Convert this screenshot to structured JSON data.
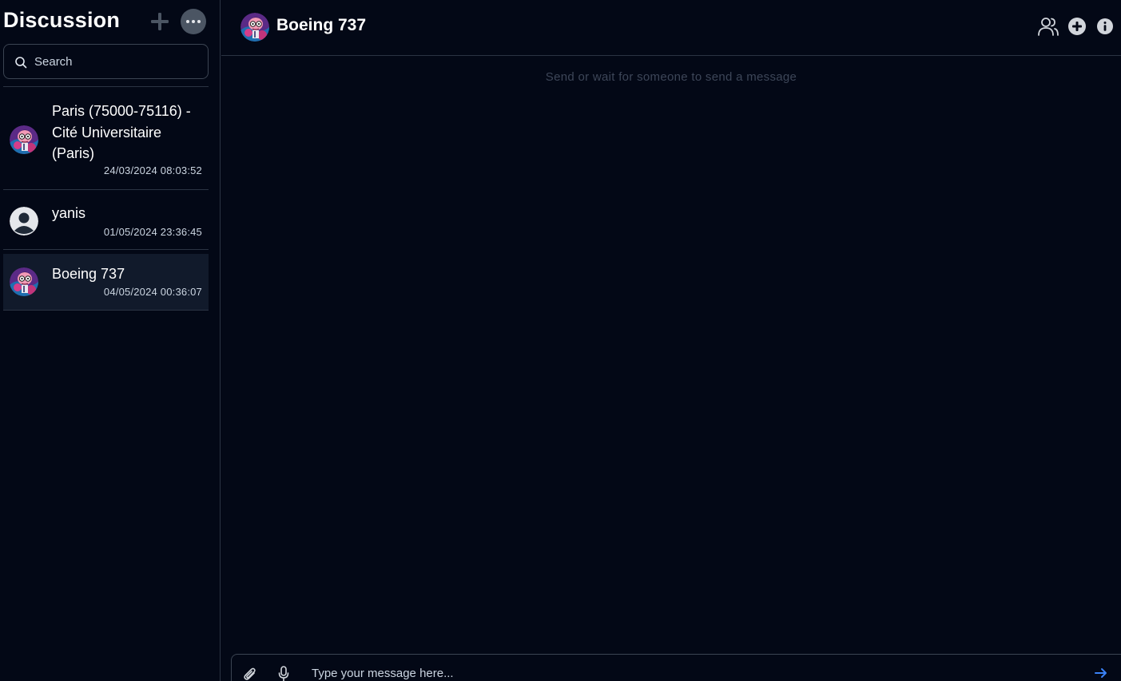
{
  "sidebar": {
    "title": "Discussion",
    "search": {
      "placeholder": "Search",
      "value": ""
    },
    "conversations": [
      {
        "name": "Paris (75000-75116) - Cité Universitaire (Paris)",
        "time": "24/03/2024 08:03:52",
        "avatar": "cartoon-avatar"
      },
      {
        "name": "yanis",
        "time": "01/05/2024 23:36:45",
        "avatar": "default-user-avatar"
      },
      {
        "name": "Boeing 737",
        "time": "04/05/2024 00:36:07",
        "avatar": "cartoon-avatar",
        "active": true
      }
    ]
  },
  "chat": {
    "title": "Boeing 737",
    "header_icons": [
      "members-icon",
      "add-circle-icon",
      "info-icon"
    ],
    "empty_message": "Send or wait for someone to send a message",
    "composer": {
      "placeholder": "Type your message here...",
      "value": ""
    }
  },
  "colors": {
    "background": "#030816",
    "active_row": "#111a2b",
    "border": "#2b3443",
    "send_accent": "#3b82f6"
  }
}
